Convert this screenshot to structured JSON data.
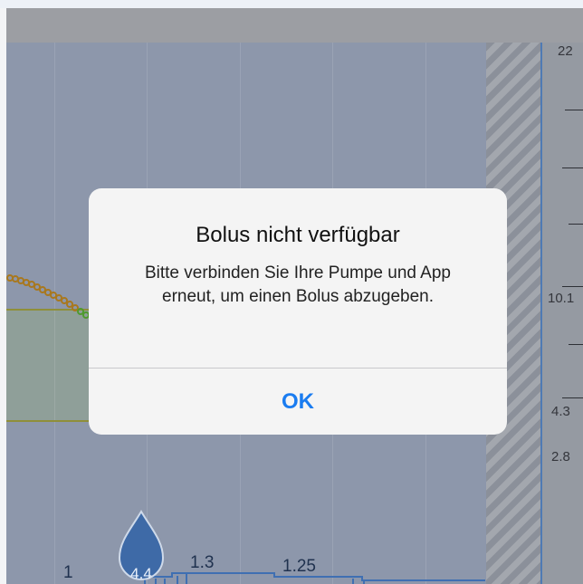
{
  "chart": {
    "y_labels": [
      "22",
      "10.1",
      "4.3",
      "2.8"
    ],
    "bolus_labels": [
      "1",
      "1.3",
      "1.25"
    ],
    "drop_value": "4.4"
  },
  "dialog": {
    "title": "Bolus nicht verfügbar",
    "message": "Bitte verbinden Sie Ihre Pumpe und App erneut, um einen Bolus abzugeben.",
    "ok_label": "OK"
  }
}
